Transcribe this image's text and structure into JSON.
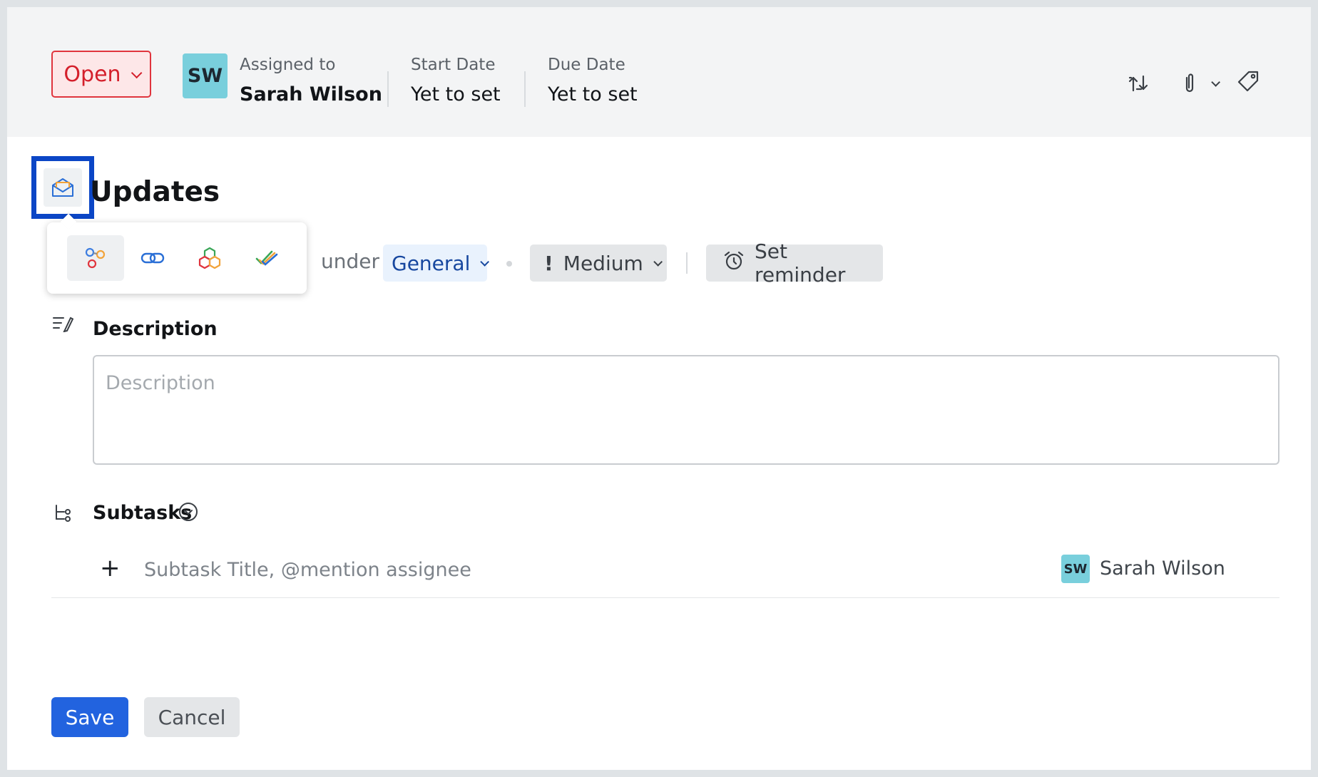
{
  "header": {
    "status": {
      "label": "Open",
      "color": "#d41f2b"
    },
    "assignee": {
      "initials": "SW",
      "label": "Assigned to",
      "name": "Sarah Wilson"
    },
    "start_date": {
      "label": "Start Date",
      "value": "Yet to set"
    },
    "due_date": {
      "label": "Due Date",
      "value": "Yet to set"
    },
    "actions": [
      "repeat-icon",
      "attachment-icon",
      "chevron-down-icon",
      "tag-icon"
    ]
  },
  "task": {
    "title": "Updates",
    "app_icon": "mail-icon",
    "app_options": [
      "integrations-icon",
      "link-icon",
      "cube-apps-icon",
      "checkmark-app-icon"
    ]
  },
  "meta_row": {
    "under_label": "under",
    "category": "General",
    "priority": "Medium",
    "reminder": "Set reminder"
  },
  "description": {
    "label": "Description",
    "placeholder": "Description"
  },
  "subtasks": {
    "label": "Subtasks",
    "add_symbol": "+",
    "placeholder": "Subtask Title, @mention assignee",
    "assignee_initials": "SW",
    "assignee_name": "Sarah Wilson"
  },
  "footer": {
    "save": "Save",
    "cancel": "Cancel",
    "accent": "#2263df"
  }
}
